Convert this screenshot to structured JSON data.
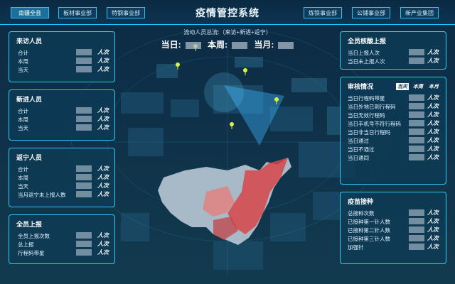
{
  "header": {
    "title": "疫情管控系统",
    "tabs_left": [
      "南疆全县",
      "板材事业部",
      "特钢事业部"
    ],
    "tabs_right": [
      "炼铁事业部",
      "公铺事业部",
      "新产业集团"
    ]
  },
  "totals": {
    "caption": "流动人员总流:（来访+新进+返宁）",
    "today": "当日:",
    "week": "本周:",
    "month": "当月:"
  },
  "left_panels": [
    {
      "title": "来访人员",
      "rows": [
        {
          "label": "合计",
          "unit": "人次"
        },
        {
          "label": "本周",
          "unit": "人次"
        },
        {
          "label": "当天",
          "unit": "人次"
        }
      ]
    },
    {
      "title": "新进人员",
      "rows": [
        {
          "label": "合计",
          "unit": "人次"
        },
        {
          "label": "本周",
          "unit": "人次"
        },
        {
          "label": "当天",
          "unit": "人次"
        }
      ]
    },
    {
      "title": "返宁人员",
      "rows": [
        {
          "label": "合计",
          "unit": "人次"
        },
        {
          "label": "本周",
          "unit": "人次"
        },
        {
          "label": "当天",
          "unit": "人次"
        },
        {
          "label": "当月返宁未上报人数",
          "unit": "人次"
        }
      ]
    },
    {
      "title": "全员上报",
      "rows": [
        {
          "label": "全员上报次数",
          "unit": "人次"
        },
        {
          "label": "总上报",
          "unit": "人次"
        },
        {
          "label": "行程码带星",
          "unit": "人次"
        }
      ]
    }
  ],
  "right_panels": [
    {
      "title": "全员核酸上报",
      "rows": [
        {
          "label": "当日上报人次",
          "unit": "人次"
        },
        {
          "label": "当日未上报人次",
          "unit": "人次"
        }
      ]
    },
    {
      "title": "审核情况",
      "col_headers": [
        "当天",
        "本周",
        "本月"
      ],
      "rows": [
        {
          "label": "当日行程码带星",
          "unit": "人次"
        },
        {
          "label": "当日外地已到行程码",
          "unit": "人次"
        },
        {
          "label": "当日无效行程码",
          "unit": "人次"
        },
        {
          "label": "当日手机号不符行程码",
          "unit": "人次"
        },
        {
          "label": "当日非当日行程码",
          "unit": "人次"
        },
        {
          "label": "当日通过",
          "unit": "人次"
        },
        {
          "label": "当日不通过",
          "unit": "人次"
        },
        {
          "label": "当日通同",
          "unit": "人次"
        }
      ]
    },
    {
      "title": "疫苗接种",
      "rows": [
        {
          "label": "总接种次数",
          "unit": "人次"
        },
        {
          "label": "已接种第一针人数",
          "unit": "人次"
        },
        {
          "label": "已接种第二针人数",
          "unit": "人次"
        },
        {
          "label": "已接种第三针人数",
          "unit": "人次"
        },
        {
          "label": "加强针",
          "unit": "人次"
        }
      ]
    }
  ],
  "colors": {
    "accent": "#33c7f2",
    "panel": "#0d3a56",
    "hot": "#d7464a"
  }
}
